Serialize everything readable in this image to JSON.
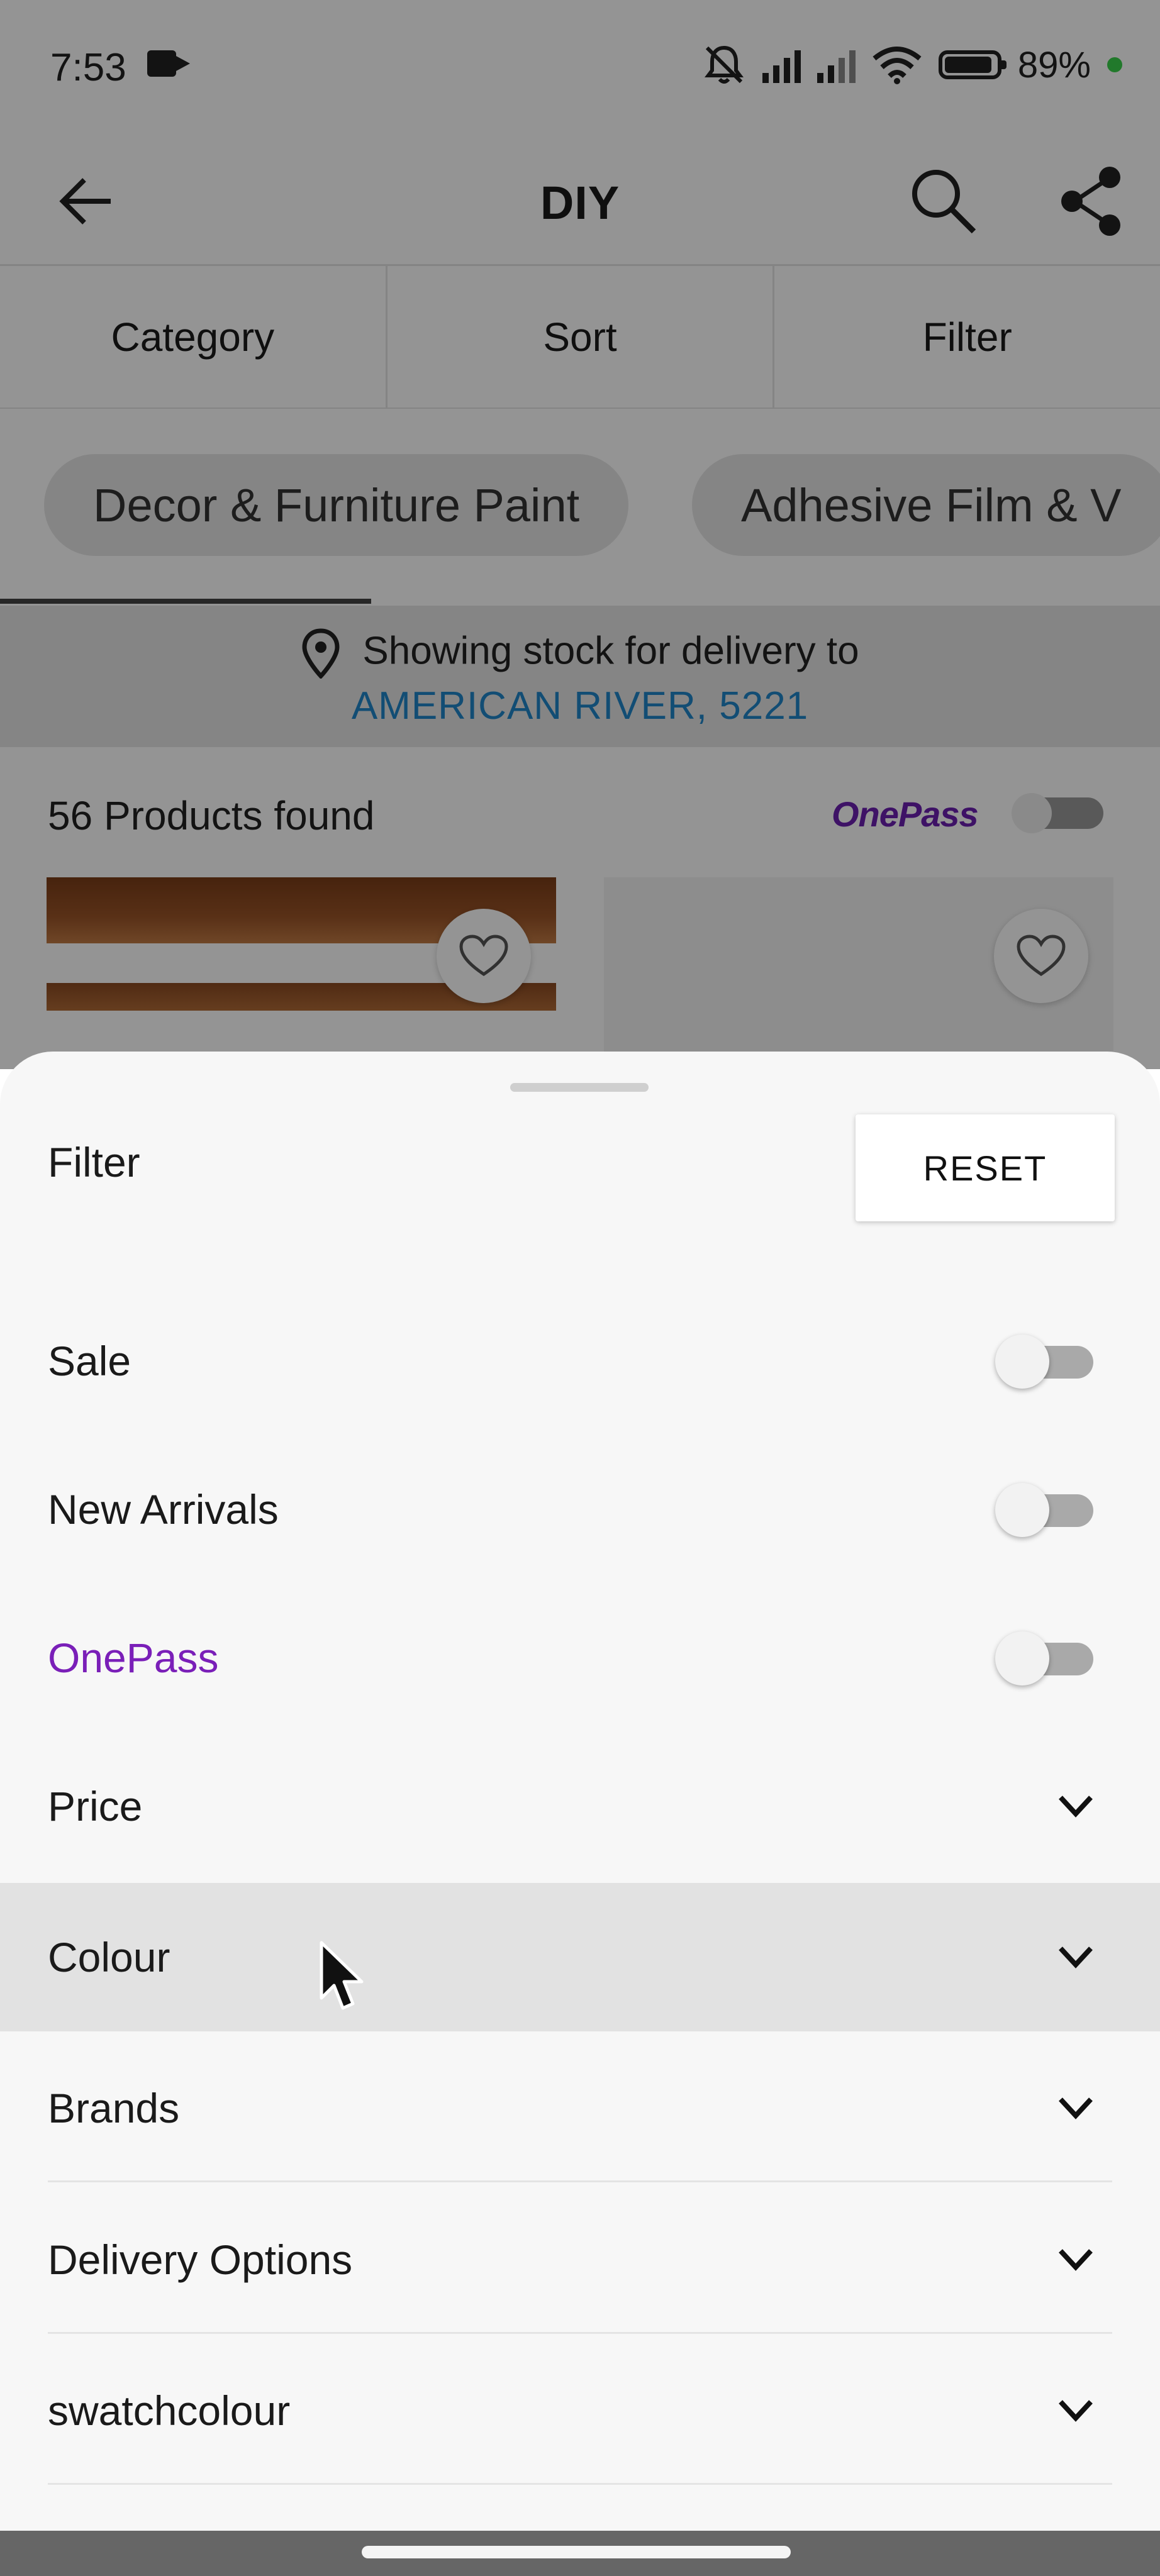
{
  "status_bar": {
    "time": "7:53",
    "battery": "89%",
    "icons": [
      "video-record-icon",
      "mute-bell-icon",
      "signal-icon",
      "signal-icon",
      "wifi-icon",
      "battery-icon",
      "notification-dot-icon"
    ]
  },
  "header": {
    "title": "DIY",
    "icons": [
      "back-arrow-icon",
      "search-icon",
      "share-icon"
    ]
  },
  "tabs": [
    {
      "label": "Category"
    },
    {
      "label": "Sort"
    },
    {
      "label": "Filter"
    }
  ],
  "chips": [
    {
      "label": "Decor & Furniture Paint"
    },
    {
      "label": "Adhesive Film & V"
    }
  ],
  "delivery": {
    "line1": "Showing stock for delivery to",
    "line2": "AMERICAN RIVER, 5221"
  },
  "results": {
    "count_text": "56 Products found",
    "onepass_logo": "OnePass",
    "onepass_toggle_on": false
  },
  "filter_sheet": {
    "title": "Filter",
    "reset_label": "RESET",
    "toggles": [
      {
        "label": "Sale",
        "on": false
      },
      {
        "label": "New Arrivals",
        "on": false
      },
      {
        "label": "OnePass",
        "on": false,
        "color": "#7a1fb8"
      }
    ],
    "sections": [
      {
        "label": "Price"
      },
      {
        "label": "Colour",
        "highlighted": true
      },
      {
        "label": "Brands"
      },
      {
        "label": "Delivery Options"
      },
      {
        "label": "swatchcolour"
      }
    ]
  },
  "colors": {
    "accent_link": "#1f86c8",
    "onepass_purple": "#7a1fb8",
    "highlight_row": "#e2e2e2"
  }
}
